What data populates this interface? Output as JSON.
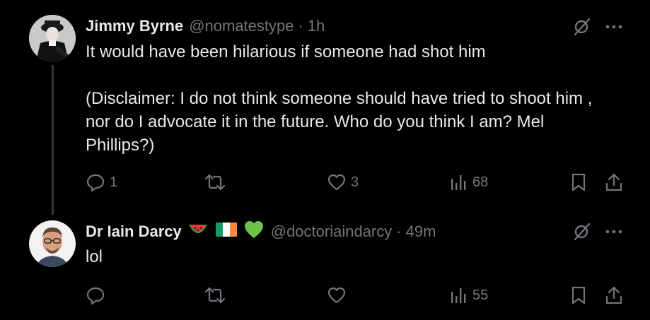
{
  "tweets": [
    {
      "author_name": "Jimmy Byrne",
      "handle": "@nomatestype",
      "separator": "·",
      "time": "1h",
      "text_lines": [
        "It would have been hilarious if someone had shot him",
        "(Disclaimer: I do not think someone should have tried to shoot him , nor do I advocate it in the future. Who do you think I am? Mel Phillips?)"
      ],
      "stats": {
        "replies": "1",
        "retweets": "",
        "likes": "3",
        "views": "68"
      }
    },
    {
      "author_name": "Dr Iain Darcy",
      "name_emojis": [
        "watermelon-emoji",
        "ireland-flag-emoji",
        "green-heart-emoji"
      ],
      "handle": "@doctoriaindarcy",
      "separator": "·",
      "time": "49m",
      "text_lines": [
        "lol"
      ],
      "stats": {
        "replies": "",
        "retweets": "",
        "likes": "",
        "views": "55"
      }
    }
  ],
  "icons": {
    "grok": "grok-icon",
    "more": "more-options-icon",
    "reply": "reply-icon",
    "retweet": "retweet-icon",
    "like": "heart-icon",
    "views": "views-chart-icon",
    "bookmark": "bookmark-icon",
    "share": "share-icon"
  },
  "colors": {
    "background": "#000000",
    "text": "#e7e9ea",
    "muted": "#71767b",
    "thread_line": "#333639"
  }
}
